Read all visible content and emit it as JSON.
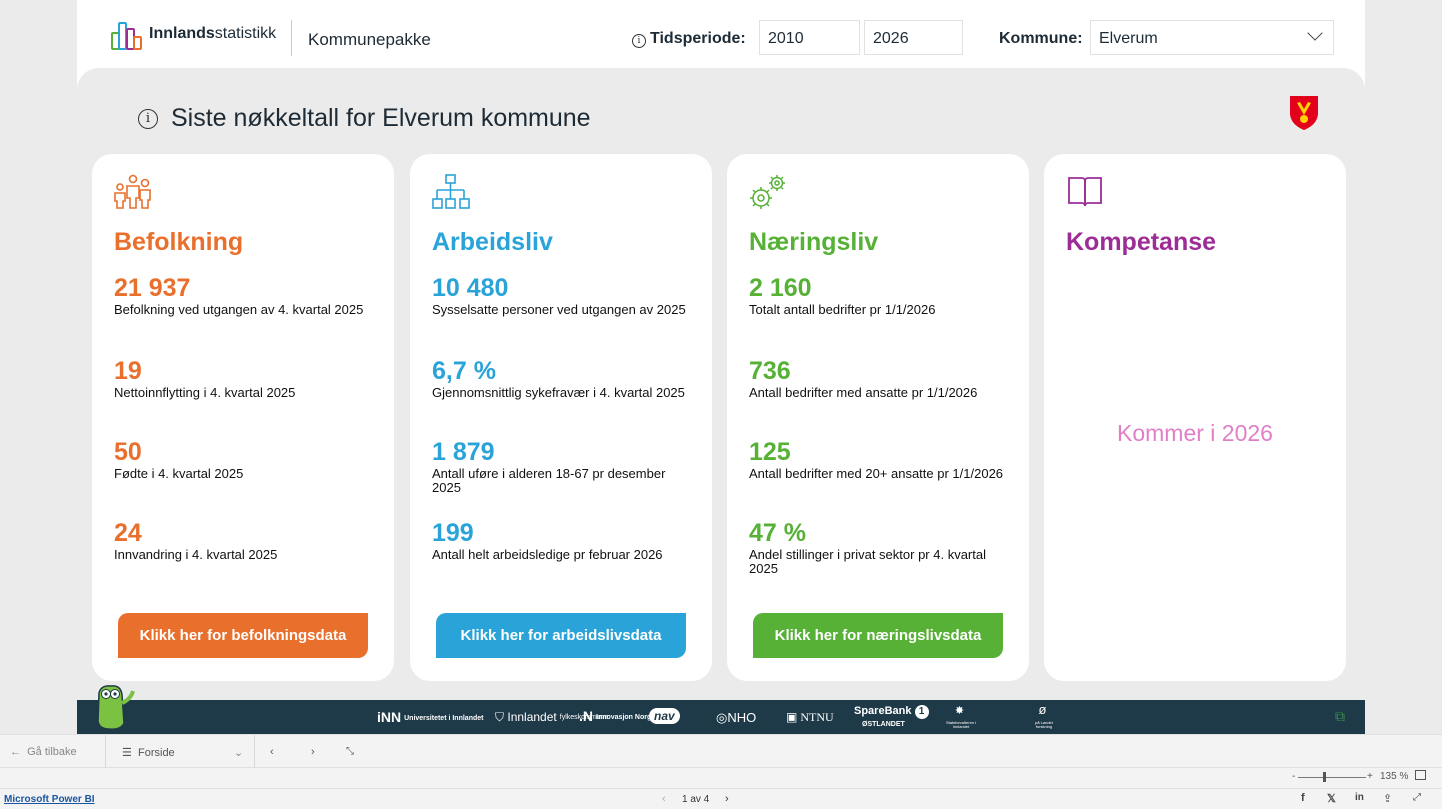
{
  "header": {
    "brand_bold": "Innlands",
    "brand_light": "statistikk",
    "app_name": "Kommunepakke",
    "period_label": "Tidsperiode:",
    "period_from": "2010",
    "period_to": "2026",
    "kommune_label": "Kommune:",
    "kommune_value": "Elverum"
  },
  "main": {
    "headline": "Siste nøkkeltall for Elverum kommune",
    "cards": [
      {
        "title": "Befolkning",
        "color": "#e86f2c",
        "kpis": [
          {
            "value": "21 937",
            "text": "Befolkning ved utgangen av 4. kvartal 2025"
          },
          {
            "value": "19",
            "text": "Nettoinnflytting i 4. kvartal 2025"
          },
          {
            "value": "50",
            "text": "Fødte i 4. kvartal 2025"
          },
          {
            "value": "24",
            "text": "Innvandring i 4. kvartal 2025"
          }
        ],
        "button": "Klikk her for befolkningsdata"
      },
      {
        "title": "Arbeidsliv",
        "color": "#2aa4d8",
        "kpis": [
          {
            "value": "10 480",
            "text": "Sysselsatte personer ved utgangen av 2025"
          },
          {
            "value": "6,7 %",
            "text": "Gjennomsnittlig sykefravær i 4. kvartal 2025"
          },
          {
            "value": "1 879",
            "text": "Antall uføre i alderen 18-67 pr desember 2025"
          },
          {
            "value": "199",
            "text": "Antall helt arbeidsledige pr februar 2026"
          }
        ],
        "button": "Klikk her for arbeidslivsdata"
      },
      {
        "title": "Næringsliv",
        "color": "#56b136",
        "kpis": [
          {
            "value": "2 160",
            "text": "Totalt antall bedrifter pr 1/1/2026"
          },
          {
            "value": "736",
            "text": "Antall bedrifter med ansatte pr 1/1/2026"
          },
          {
            "value": "125",
            "text": "Antall bedrifter med 20+ ansatte pr 1/1/2026"
          },
          {
            "value": "47 %",
            "text": "Andel stillinger i privat sektor pr 4. kvartal 2025"
          }
        ],
        "button": "Klikk her for næringslivsdata"
      },
      {
        "title": "Kompetanse",
        "color": "#9c2d96",
        "coming_soon": "Kommer i 2026"
      }
    ]
  },
  "partners": [
    {
      "name": "iNN",
      "sub": "Universitetet i Innlandet"
    },
    {
      "name": "Innlandet",
      "sub": "fylkeskommune"
    },
    {
      "name": ".N",
      "sub": "Innovasjon Norge"
    },
    {
      "name": "nav",
      "sub": ""
    },
    {
      "name": "NHO",
      "sub": ""
    },
    {
      "name": "NTNU",
      "sub": ""
    },
    {
      "name": "SpareBank",
      "sub": "ØSTLANDET"
    },
    {
      "name": "",
      "sub": "Statsforvalteren i Innlandet"
    },
    {
      "name": "",
      "sub": "på Landet forskning"
    }
  ],
  "nav": {
    "back": "Gå tilbake",
    "page": "Forside"
  },
  "zoom": {
    "level": "135 %",
    "minus": "-",
    "plus": "+"
  },
  "status": {
    "link": "Microsoft Power BI",
    "pager": "1 av 4"
  },
  "colors": {
    "footer": "#1e3a48",
    "panel": "#ebebeb",
    "kompetanse_coming": "#e07fc8"
  }
}
